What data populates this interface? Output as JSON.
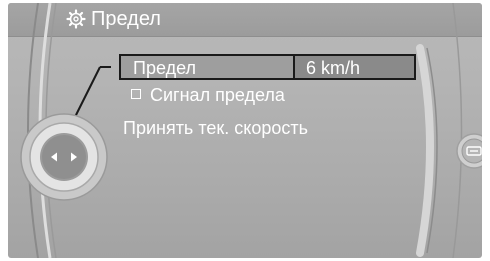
{
  "header": {
    "title": "Предел",
    "icon": "gear-icon"
  },
  "menu": {
    "limit_row": {
      "label": "Предел",
      "value": "6 km/h"
    },
    "signal_item": {
      "label": "Сигнал предела",
      "checked": false
    },
    "accept_item": {
      "label": "Принять тек. скорость"
    }
  },
  "colors": {
    "background": "#b4b4b4",
    "text": "#ffffff",
    "selection_border": "#1a1a1a"
  }
}
